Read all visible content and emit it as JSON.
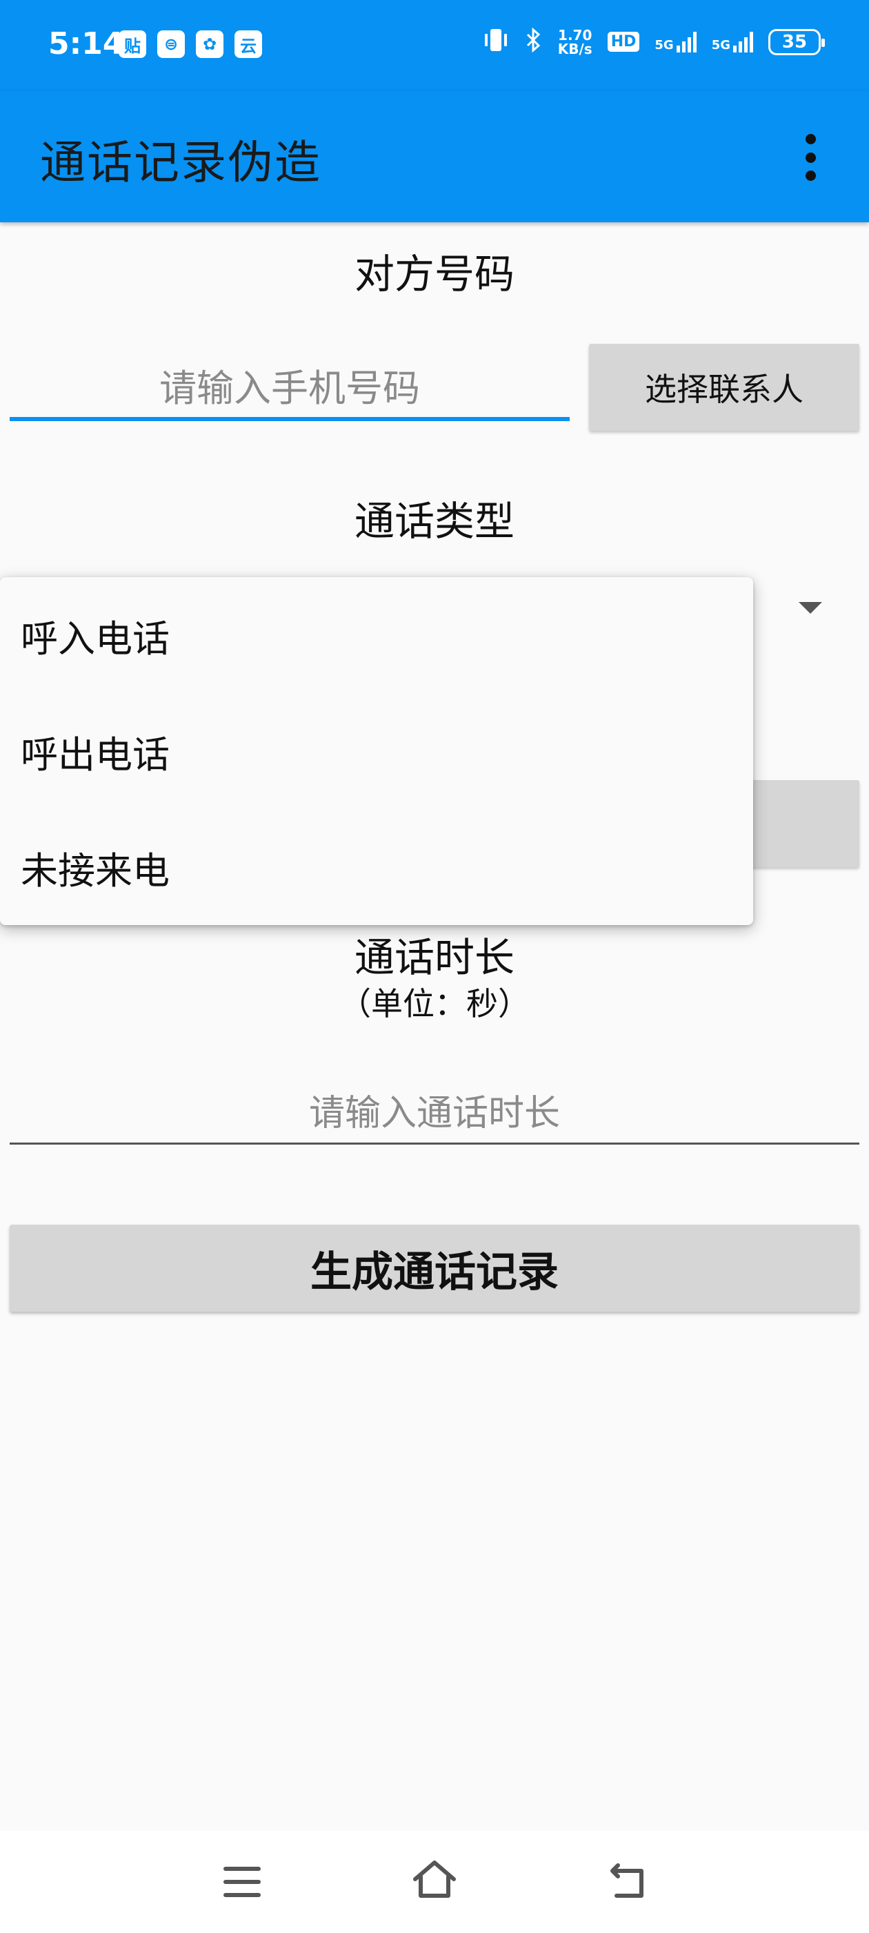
{
  "status_bar": {
    "time": "5:14",
    "notification_icons": [
      "贴",
      "⊜",
      "✿",
      "云"
    ],
    "net_speed_value": "1.70",
    "net_speed_unit": "KB/s",
    "hd_label": "HD",
    "sim1_label": "5G",
    "sim2_label": "5G",
    "battery": "35"
  },
  "app_bar": {
    "title": "通话记录伪造",
    "more_icon": "more-vertical-icon"
  },
  "form": {
    "phone_label": "对方号码",
    "phone_placeholder": "请输入手机号码",
    "phone_value": "",
    "contact_button": "选择联系人",
    "call_type_label": "通话类型",
    "duration_label": "通话时长",
    "duration_unit": "（单位：秒）",
    "duration_placeholder": "请输入通话时长",
    "duration_value": "",
    "generate_button": "生成通话记录"
  },
  "dropdown": {
    "options": [
      "呼入电话",
      "呼出电话",
      "未接来电"
    ]
  },
  "nav_bar": {
    "menu_icon": "menu-icon",
    "home_icon": "home-icon",
    "back_icon": "back-icon"
  },
  "colors": {
    "primary": "#0791f2",
    "background": "#fafafa",
    "button": "#d6d6d6"
  }
}
